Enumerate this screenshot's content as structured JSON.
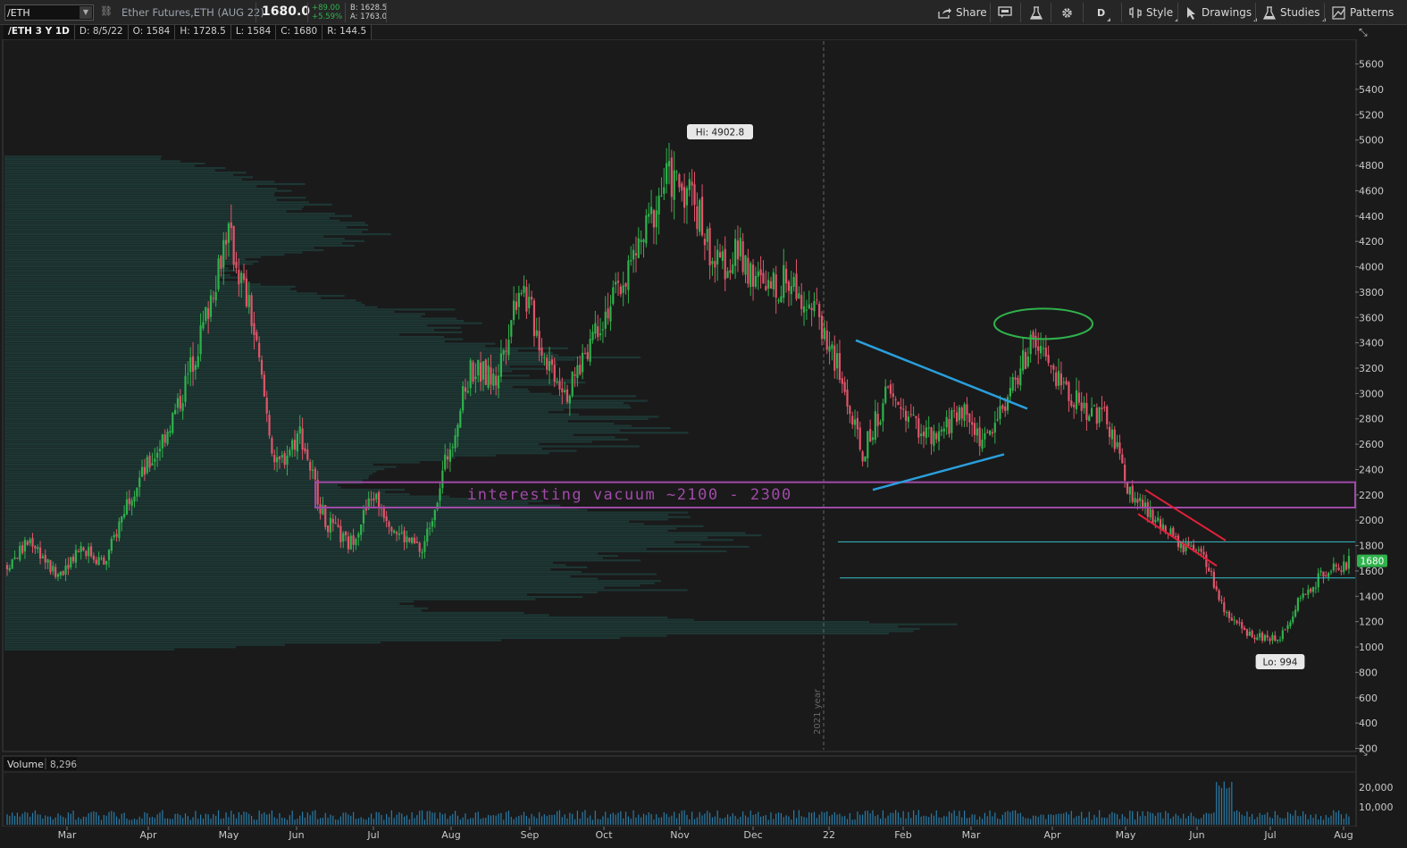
{
  "toolbar": {
    "symbol_value": "/ETH",
    "description": "Ether Futures,ETH (AUG 22)",
    "last_price": "1680.0",
    "net_change": "+89.00",
    "pct_change": "+5.59%",
    "bid": "B: 1628.5",
    "ask": "A: 1763.0",
    "share_label": "Share",
    "aggregation_label": "D",
    "style_label": "Style",
    "drawings_label": "Drawings",
    "studies_label": "Studies",
    "patterns_label": "Patterns"
  },
  "infobar": {
    "title": "/ETH 3 Y 1D",
    "date": "D: 8/5/22",
    "open": "O: 1584",
    "high": "H: 1728.5",
    "low": "L: 1584",
    "close": "C: 1680",
    "range": "R: 144.5"
  },
  "volume_panel": {
    "label": "Volume",
    "value": "8,296"
  },
  "colors": {
    "background": "#1a1a1a",
    "up": "#2fb24c",
    "down": "#e0556a",
    "profile": "#1f3d3a",
    "annotation_rect": "#a04aa8",
    "triangle_lines": "#2a9fdc",
    "ellipse": "#2fb24c",
    "channel": "#e0203a",
    "level_lines": "#36c0c8",
    "price_marker": "#2fb24c"
  },
  "chart_data": {
    "type": "candlestick",
    "yticks": [
      200,
      400,
      600,
      800,
      1000,
      1200,
      1400,
      1600,
      1800,
      2000,
      2200,
      2400,
      2600,
      2800,
      3000,
      3200,
      3400,
      3600,
      3800,
      4000,
      4200,
      4400,
      4600,
      4800,
      5000,
      5200,
      5400,
      5600
    ],
    "xticks": [
      "Mar",
      "Apr",
      "May",
      "Jun",
      "Jul",
      "Aug",
      "Sep",
      "Oct",
      "Nov",
      "Dec",
      "22",
      "Feb",
      "Mar",
      "Apr",
      "May",
      "Jun",
      "Jul",
      "Aug"
    ],
    "close_path": [
      [
        "Mar",
        1650
      ],
      [
        "Mar",
        1850
      ],
      [
        "Mar",
        1550
      ],
      [
        "Apr",
        1800
      ],
      [
        "Apr",
        1650
      ],
      [
        "Apr",
        2200
      ],
      [
        "Apr",
        2500
      ],
      [
        "Apr",
        2900
      ],
      [
        "May",
        3500
      ],
      [
        "May",
        4300
      ],
      [
        "May",
        3600
      ],
      [
        "Jun",
        2400
      ],
      [
        "Jun",
        2700
      ],
      [
        "Jun",
        2000
      ],
      [
        "Jun",
        1800
      ],
      [
        "Jul",
        2200
      ],
      [
        "Jul",
        1900
      ],
      [
        "Jul",
        1750
      ],
      [
        "Aug",
        2500
      ],
      [
        "Aug",
        3200
      ],
      [
        "Aug",
        3100
      ],
      [
        "Sep",
        3900
      ],
      [
        "Sep",
        3300
      ],
      [
        "Sep",
        3000
      ],
      [
        "Oct",
        3500
      ],
      [
        "Oct",
        3800
      ],
      [
        "Oct",
        4200
      ],
      [
        "Nov",
        4700
      ],
      [
        "Nov",
        4600
      ],
      [
        "Nov",
        4000
      ],
      [
        "Dec",
        4100
      ],
      [
        "Dec",
        3800
      ],
      [
        "Dec",
        3900
      ],
      [
        "22",
        3700
      ],
      [
        "22",
        3200
      ],
      [
        "22",
        2500
      ],
      [
        "Feb",
        3000
      ],
      [
        "Feb",
        2800
      ],
      [
        "Feb",
        2600
      ],
      [
        "Mar",
        2900
      ],
      [
        "Mar",
        2600
      ],
      [
        "Mar",
        3000
      ],
      [
        "Apr",
        3400
      ],
      [
        "Apr",
        3100
      ],
      [
        "Apr",
        2900
      ],
      [
        "May",
        2800
      ],
      [
        "May",
        2200
      ],
      [
        "May",
        2000
      ],
      [
        "Jun",
        1800
      ],
      [
        "Jun",
        1700
      ],
      [
        "Jun",
        1200
      ],
      [
        "Jul",
        1100
      ],
      [
        "Jul",
        1050
      ],
      [
        "Jul",
        1400
      ],
      [
        "Aug",
        1600
      ],
      [
        "Aug",
        1680
      ]
    ],
    "volume_yticks": [
      "20,000",
      "10,000"
    ],
    "annotations": {
      "high_label": "Hi: 4902.8",
      "low_label": "Lo: 994",
      "year_label": "2021 year",
      "vacuum_text": "interesting vacuum ~2100 - 2300",
      "current_price_label": "1680"
    },
    "levels": [
      1830,
      1545
    ],
    "vacuum_zone": [
      2100,
      2300
    ]
  }
}
